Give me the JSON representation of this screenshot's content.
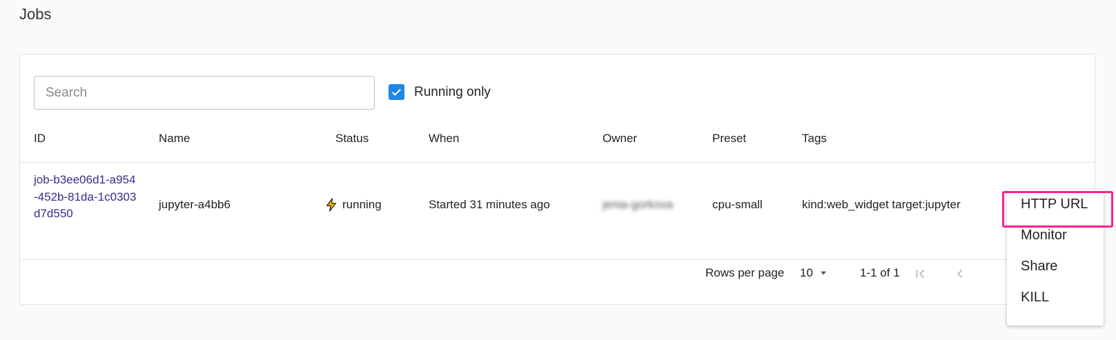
{
  "page": {
    "title": "Jobs"
  },
  "toolbar": {
    "search_placeholder": "Search",
    "search_value": "",
    "running_only_label": "Running only",
    "running_only_checked": true
  },
  "table": {
    "columns": [
      "ID",
      "Name",
      "Status",
      "When",
      "Owner",
      "Preset",
      "Tags"
    ],
    "rows": [
      {
        "id": "job-b3ee06d1-a954-452b-81da-1c0303d7d550",
        "name": "jupyter-a4bb6",
        "status": "running",
        "status_icon": "lightning-icon",
        "when": "Started 31 minutes ago",
        "owner": "jenia-gorkova",
        "preset": "cpu-small",
        "tags": "kind:web_widget target:jupyter"
      }
    ]
  },
  "pagination": {
    "rows_per_page_label": "Rows per page",
    "rows_per_page_value": "10",
    "range": "1-1 of 1"
  },
  "menu": {
    "items": [
      "HTTP URL",
      "Monitor",
      "Share",
      "KILL"
    ],
    "highlighted": "HTTP URL"
  },
  "colors": {
    "accent": "#1f87e5",
    "link": "#3b2a8a",
    "status_icon": "#f4b400",
    "highlight": "#ff1f8a"
  }
}
